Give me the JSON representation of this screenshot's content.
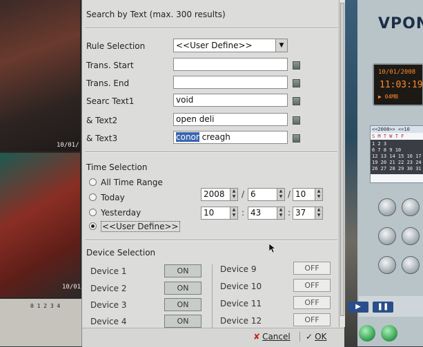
{
  "dialog": {
    "title": "Search by Text  (max. 300 results)",
    "rule_selection_label": "Rule Selection",
    "rule_selection_value": "<<User Define>>",
    "fields": [
      {
        "label": "Trans. Start",
        "value": ""
      },
      {
        "label": "Trans. End",
        "value": ""
      },
      {
        "label": "Searc Text1",
        "value": "void"
      },
      {
        "label": "& Text2",
        "value": "open deli"
      },
      {
        "label": "& Text3",
        "value_selected": "conor",
        "value_rest": " creagh"
      }
    ],
    "time_selection": {
      "label": "Time Selection",
      "options": [
        "All Time Range",
        "Today",
        "Yesterday",
        "<<User Define>>"
      ],
      "selected": "<<User Define>>",
      "date": {
        "year": "2008",
        "month": "6",
        "day": "10",
        "sep": "/"
      },
      "time": {
        "hour": "10",
        "minute": "43",
        "second": "37",
        "sep": ":"
      }
    },
    "device_selection": {
      "label": "Device Selection",
      "left": [
        {
          "name": "Device 1",
          "state": "ON"
        },
        {
          "name": "Device 2",
          "state": "ON"
        },
        {
          "name": "Device 3",
          "state": "ON"
        },
        {
          "name": "Device 4",
          "state": "ON"
        }
      ],
      "right": [
        {
          "name": "Device 9",
          "state": "OFF"
        },
        {
          "name": "Device 10",
          "state": "OFF"
        },
        {
          "name": "Device 11",
          "state": "OFF"
        },
        {
          "name": "Device 12",
          "state": "OFF"
        }
      ]
    },
    "buttons": {
      "cancel": "Cancel",
      "ok": "OK"
    }
  },
  "background": {
    "brand": "VPON",
    "lcd_date": "10/01/2008",
    "lcd_time": "11:03:19",
    "lcd_mode": "▶ 04MB",
    "cam_stamp_1": "10/01/",
    "cam_stamp_2": "10/01/",
    "calendar_header": "<<2008>> <<10",
    "calendar_dow": "S M T W T F",
    "calendar_rows": [
      "          1  2  3",
      "6  7  8  9 10",
      "12 13 14 15 16 17",
      "19 20 21 22 23 24",
      "26 27 28 29 30 31"
    ],
    "mini_ruler": "0 1 2 3 4"
  },
  "colors": {
    "selection": "#3a66b0",
    "dialog_bg": "#dcdcda"
  }
}
